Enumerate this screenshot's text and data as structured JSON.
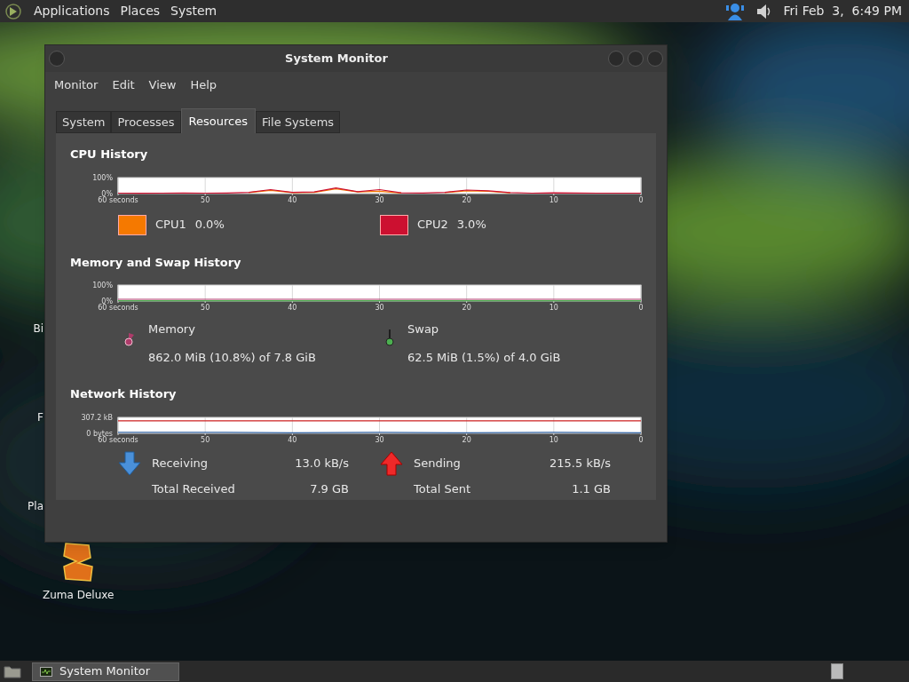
{
  "top_panel": {
    "menus": [
      "Applications",
      "Places",
      "System"
    ],
    "clock": "Fri Feb  3,  6:49 PM"
  },
  "desktop_icons": [
    {
      "label": "Bi",
      "kind": "hidden"
    },
    {
      "label": "F",
      "kind": "hidden"
    },
    {
      "label": "Pla",
      "kind": "hidden"
    },
    {
      "label": "Zuma Deluxe",
      "kind": "game"
    }
  ],
  "window": {
    "title": "System Monitor",
    "menu": [
      "Monitor",
      "Edit",
      "View",
      "Help"
    ],
    "tabs": [
      {
        "label": "System",
        "selected": false
      },
      {
        "label": "Processes",
        "selected": false
      },
      {
        "label": "Resources",
        "selected": true
      },
      {
        "label": "File Systems",
        "selected": false
      }
    ],
    "cpu": {
      "title": "CPU History",
      "chart_data": {
        "type": "line",
        "grid": true,
        "x": [
          60,
          57.5,
          55,
          52.5,
          50,
          47.5,
          45,
          42.5,
          40,
          37.5,
          35,
          32.5,
          30,
          27.5,
          25,
          22.5,
          20,
          17.5,
          15,
          12.5,
          10,
          7.5,
          5,
          2.5,
          0
        ],
        "xlim": [
          60,
          0
        ],
        "ylim": [
          0,
          100
        ],
        "xticks": [
          {
            "value": 60,
            "label": "60 seconds"
          },
          50,
          40,
          30,
          20,
          10,
          0
        ],
        "yticks": [
          {
            "value": 0,
            "label": "0%"
          },
          {
            "value": 100,
            "label": "100%"
          }
        ],
        "series": [
          {
            "color": "#f57900",
            "values": [
              null,
              null,
              null,
              null,
              null,
              null,
              6,
              20,
              6,
              8,
              30,
              10,
              15,
              4,
              null,
              6,
              18,
              14,
              5,
              null,
              null,
              null,
              null,
              null,
              null
            ]
          },
          {
            "color": "#cc1030",
            "values": [
              3,
              2,
              3,
              4,
              3,
              4,
              8,
              25,
              8,
              10,
              35,
              12,
              25,
              5,
              4,
              8,
              22,
              18,
              6,
              3,
              5,
              4,
              3,
              3,
              3
            ]
          }
        ]
      },
      "legend": [
        {
          "name": "CPU1",
          "value": "0.0%",
          "color": "#f57900"
        },
        {
          "name": "CPU2",
          "value": "3.0%",
          "color": "#cc1030"
        }
      ]
    },
    "memory": {
      "title": "Memory and Swap History",
      "chart_data": {
        "type": "line",
        "grid": true,
        "x": [
          60,
          0
        ],
        "xlim": [
          60,
          0
        ],
        "ylim": [
          0,
          100
        ],
        "xticks": [
          {
            "value": 60,
            "label": "60 seconds"
          },
          50,
          40,
          30,
          20,
          10,
          0
        ],
        "yticks": [
          {
            "value": 0,
            "label": "0%"
          },
          {
            "value": 100,
            "label": "100%"
          }
        ],
        "series": [
          {
            "color": "#ad3b6a",
            "values": [
              11,
              11
            ]
          },
          {
            "color": "#4caf50",
            "values": [
              2,
              2
            ]
          }
        ]
      },
      "items": [
        {
          "label": "Memory",
          "value": "862.0 MiB (10.8%) of 7.8 GiB",
          "color": "#ad3b6a"
        },
        {
          "label": "Swap",
          "value": "62.5 MiB (1.5%) of 4.0 GiB",
          "color": "#4caf50"
        }
      ]
    },
    "network": {
      "title": "Network History",
      "chart_data": {
        "type": "line",
        "grid": true,
        "x": [
          60,
          50,
          40,
          30,
          20,
          10,
          0
        ],
        "xlim": [
          60,
          0
        ],
        "ylim": [
          0,
          307.2
        ],
        "xticks": [
          {
            "value": 60,
            "label": "60 seconds"
          },
          50,
          40,
          30,
          20,
          10,
          0
        ],
        "yticks": [
          {
            "value": 0,
            "label": "0 bytes"
          },
          {
            "value": 307.2,
            "label": "307.2 kB"
          }
        ],
        "series": [
          {
            "color": "#3465a4",
            "values": [
              20,
              20,
              10,
              20,
              10,
              20,
              10
            ]
          },
          {
            "color": "#cc2020",
            "values": [
              240,
              240,
              240,
              240,
              240,
              240,
              240
            ]
          }
        ]
      },
      "stats": [
        {
          "kind": "receiving",
          "label": "Receiving",
          "value": "13.0 kB/s",
          "total_label": "Total Received",
          "total": "7.9 GB"
        },
        {
          "kind": "sending",
          "label": "Sending",
          "value": "215.5 kB/s",
          "total_label": "Total Sent",
          "total": "1.1 GB"
        }
      ]
    }
  },
  "taskbar": {
    "tasks": [
      "System Monitor"
    ]
  }
}
